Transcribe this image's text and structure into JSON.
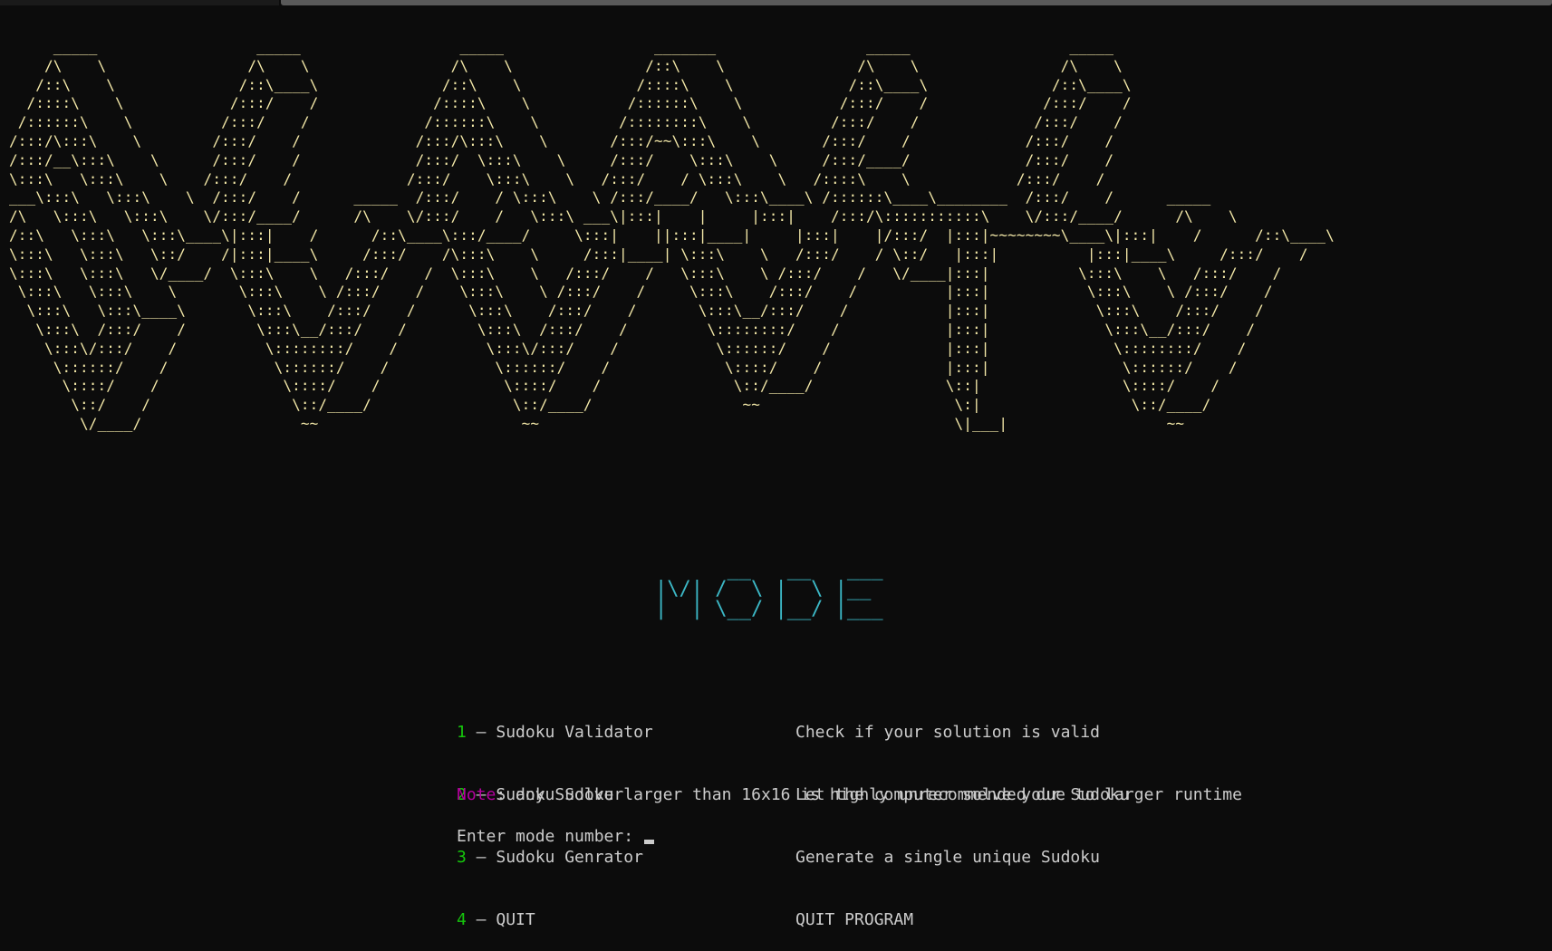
{
  "banner": {
    "ascii": "     _____                  _____                  _____                 _______                 _____                  _____\n    /\\    \\                /\\    \\                /\\    \\               /::\\    \\               /\\    \\                /\\    \\\n   /::\\    \\              /::\\____\\              /::\\    \\             /::::\\    \\             /::\\____\\              /::\\____\\\n  /::::\\    \\            /:::/    /             /::::\\    \\           /::::::\\    \\           /:::/    /             /:::/    /\n /::::::\\    \\          /:::/    /             /::::::\\    \\         /::::::::\\    \\         /:::/    /             /:::/    /\n/:::/\\:::\\    \\        /:::/    /             /:::/\\:::\\    \\       /:::/~~\\:::\\    \\       /:::/    /             /:::/    /\n/:::/__\\:::\\    \\      /:::/    /             /:::/  \\:::\\    \\     /:::/    \\:::\\    \\     /:::/____/             /:::/    /\n\\:::\\   \\:::\\    \\    /:::/    /             /:::/    \\:::\\    \\   /:::/    / \\:::\\    \\   /::::\\    \\            /:::/    /\n___\\:::\\   \\:::\\    \\  /:::/    /      _____  /:::/    / \\:::\\    \\ /:::/____/   \\:::\\____\\ /::::::\\____\\________  /:::/    /      _____\n/\\   \\:::\\   \\:::\\    \\/:::/____/      /\\    \\/:::/    /   \\:::\\ ___\\|:::|    |     |:::|    /:::/\\:::::::::::\\    \\/:::/____/      /\\    \\\n/::\\   \\:::\\   \\:::\\____\\|:::|    /      /::\\____\\:::/____/     \\:::|    ||:::|____|     |:::|    |/:::/  |:::|~~~~~~~~\\____\\|:::|    /      /::\\____\\\n\\:::\\   \\:::\\   \\::/    /|:::|____\\     /:::/    /\\:::\\    \\     /:::|____| \\:::\\    \\   /:::/    / \\::/   |:::|          |:::|____\\     /:::/    /\n\\:::\\   \\:::\\   \\/____/  \\:::\\    \\   /:::/    /  \\:::\\    \\   /:::/    /   \\:::\\    \\ /:::/    /   \\/____|:::|          \\:::\\    \\   /:::/    /\n \\:::\\   \\:::\\    \\       \\:::\\    \\ /:::/    /    \\:::\\    \\ /:::/    /     \\:::\\    /:::/    /          |:::|           \\:::\\    \\ /:::/    /\n  \\:::\\   \\:::\\____\\       \\:::\\    /:::/    /      \\:::\\    /:::/    /       \\:::\\__/:::/    /           |:::|            \\:::\\    /:::/    /\n   \\:::\\  /:::/    /        \\:::\\__/:::/    /        \\:::\\  /:::/    /         \\::::::::/    /            |:::|             \\:::\\__/:::/    /\n    \\:::\\/:::/    /          \\::::::::/    /          \\:::\\/:::/    /           \\::::::/    /             |:::|              \\::::::::/    /\n     \\::::::/    /            \\::::::/    /            \\::::::/    /             \\::::/    /              |:::|               \\::::::/    /\n      \\::::/    /              \\::::/    /              \\::::/    /               \\::/____/               \\::|                \\::::/    /\n       \\::/    /                \\::/____/                \\::/____/                 ~~                      \\:|                 \\::/____/\n        \\/____/                  ~~                       ~~                                               \\|___|                  ~~"
  },
  "mode_title": {
    "ascii": "      __   __   ___\n|\\/| /  \\ |  \\ |__\n|  | \\__/ |__/ |___"
  },
  "menu": {
    "items": [
      {
        "number": "1",
        "label": " – Sudoku Validator",
        "description": "Check if your solution is valid"
      },
      {
        "number": "2",
        "label": " – Sudoku Solver",
        "description": "Let the computer solve your Sudoku"
      },
      {
        "number": "3",
        "label": " – Sudoku Genrator",
        "description": "Generate a single unique Sudoku"
      },
      {
        "number": "4",
        "label": " – QUIT",
        "description": "QUIT PROGRAM"
      }
    ]
  },
  "note": {
    "label": "Note",
    "text": ": any Sudoku larger than 16x16 is highly unrecommended due to larger runtime"
  },
  "prompt": {
    "text": "Enter mode number: "
  },
  "colors": {
    "background": "#0c0c0c",
    "banner": "#f3e8a8",
    "mode_title": "#3cb8c6",
    "menu_number": "#16c60c",
    "note_label": "#b4009e",
    "text": "#cccccc"
  }
}
